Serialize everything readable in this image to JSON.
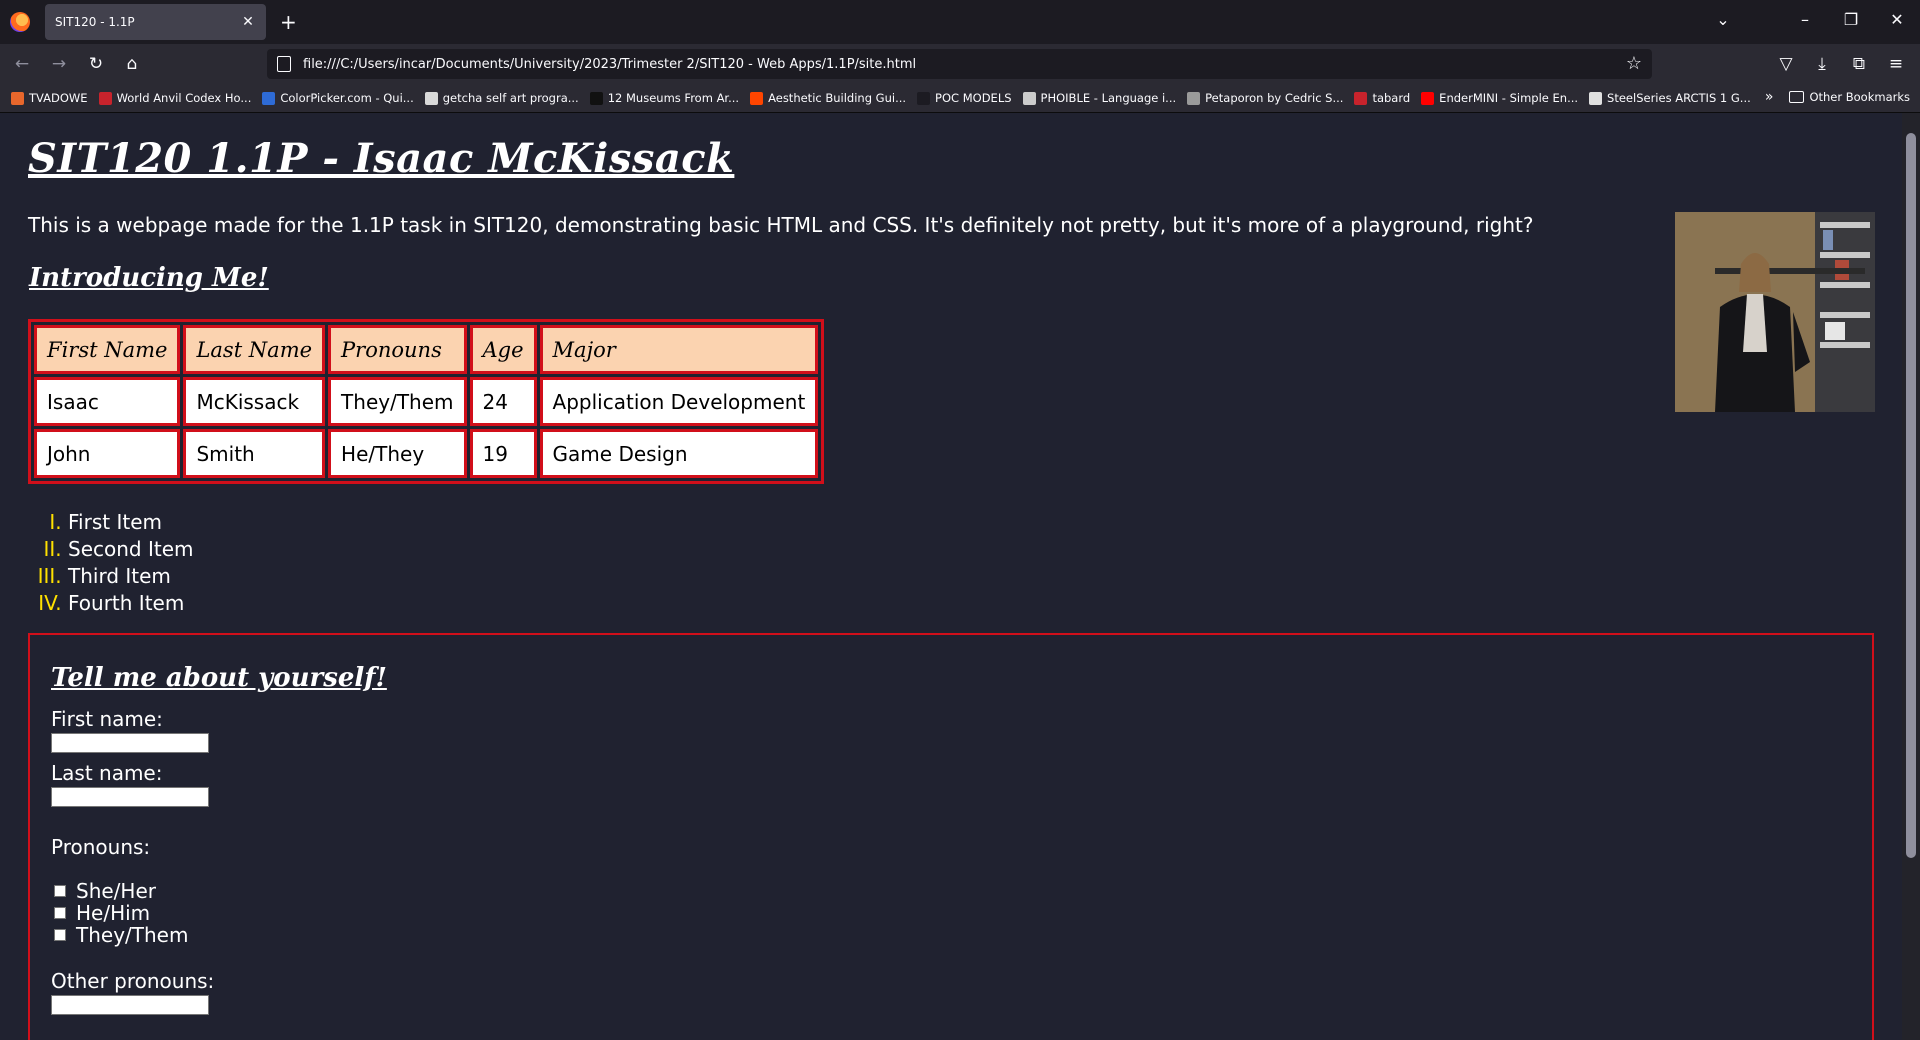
{
  "browser": {
    "tab_title": "SIT120 - 1.1P",
    "url": "file:///C:/Users/incar/Documents/University/2023/Trimester 2/SIT120 - Web Apps/1.1P/site.html",
    "bookmarks": [
      {
        "label": "TVADOWE",
        "color": "#e8672c"
      },
      {
        "label": "World Anvil Codex Ho...",
        "color": "#c8232c"
      },
      {
        "label": "ColorPicker.com - Qui...",
        "color": "#2e6bd6"
      },
      {
        "label": "getcha self art progra...",
        "color": "#d9d9d9"
      },
      {
        "label": "12 Museums From Ar...",
        "color": "#111111"
      },
      {
        "label": "Aesthetic Building Gui...",
        "color": "#ff4500"
      },
      {
        "label": "POC MODELS",
        "color": "#1c1b22"
      },
      {
        "label": "PHOIBLE - Language i...",
        "color": "#cccccc"
      },
      {
        "label": "Petaporon by Cedric S...",
        "color": "#9a9a9a"
      },
      {
        "label": "tabard",
        "color": "#c8232c"
      },
      {
        "label": "EnderMINI - Simple En...",
        "color": "#ff0000"
      },
      {
        "label": "SteelSeries ARCTIS 1 G...",
        "color": "#e0e0e0"
      }
    ],
    "other_bookmarks": "Other Bookmarks"
  },
  "page": {
    "title": "SIT120 1.1P - Isaac McKissack",
    "intro": "This is a webpage made for the 1.1P task in SIT120, demonstrating basic HTML and CSS. It's definitely not pretty, but it's more of a playground, right?",
    "subtitle": "Introducing Me!",
    "table": {
      "headers": [
        "First Name",
        "Last Name",
        "Pronouns",
        "Age",
        "Major"
      ],
      "rows": [
        [
          "Isaac",
          "McKissack",
          "They/Them",
          "24",
          "Application Development"
        ],
        [
          "John",
          "Smith",
          "He/They",
          "19",
          "Game Design"
        ]
      ]
    },
    "list": [
      "First Item",
      "Second Item",
      "Third Item",
      "Fourth Item"
    ],
    "form": {
      "title": "Tell me about yourself!",
      "first_name_label": "First name:",
      "last_name_label": "Last name:",
      "pronouns_label": "Pronouns:",
      "pronoun_options": [
        "She/Her",
        "He/Him",
        "They/Them"
      ],
      "other_pronouns_label": "Other pronouns:"
    }
  },
  "colors": {
    "accent_border": "#d10f1a",
    "table_header_bg": "#fbd3b0",
    "list_marker": "#ffe100",
    "page_bg": "#202230"
  }
}
